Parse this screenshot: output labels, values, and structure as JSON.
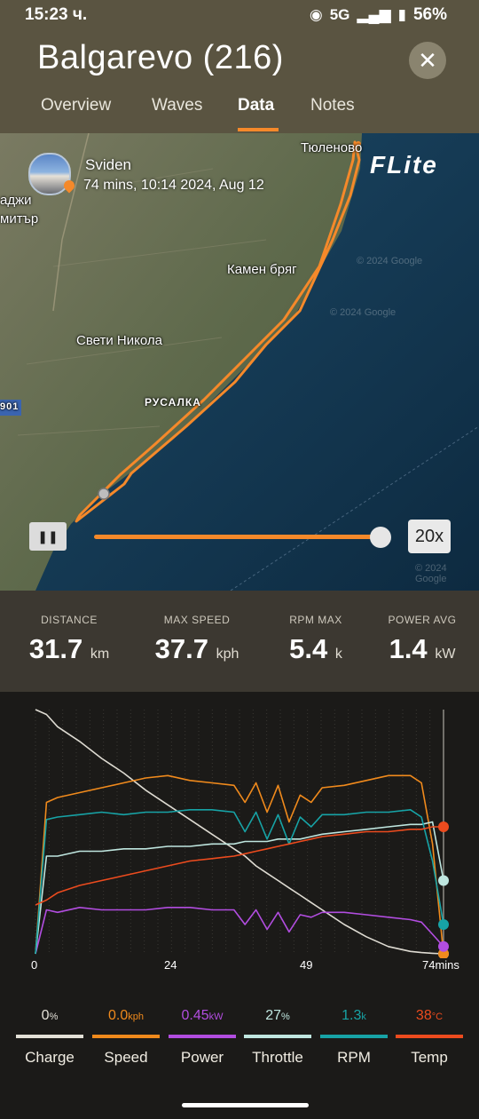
{
  "status_bar": {
    "time": "15:23 ч.",
    "network": "5G",
    "battery": "56%"
  },
  "header": {
    "title": "Balgarevo (216)",
    "close_icon": "close-icon"
  },
  "tabs": [
    {
      "label": "Overview",
      "active": false
    },
    {
      "label": "Waves",
      "active": false
    },
    {
      "label": "Data",
      "active": true
    },
    {
      "label": "Notes",
      "active": false
    }
  ],
  "map": {
    "brand": "FLite",
    "session": {
      "name": "Sviden",
      "meta": "74 mins, 10:14 2024, Aug 12"
    },
    "labels": {
      "tyulenovo": "Тюленово",
      "kamen_bryag": "Камен бряг",
      "sveti_nikola": "Свети Никола",
      "rusalka": "РУСАЛКА",
      "hadzhi": "аджи",
      "dimitar": "митър",
      "road": "901"
    },
    "watermark": "© 2024 Google",
    "playback": {
      "speed_label": "20x",
      "progress": 1.0,
      "pause_icon": "pause-icon"
    }
  },
  "stats": [
    {
      "label": "DISTANCE",
      "value": "31.7",
      "unit": "km"
    },
    {
      "label": "MAX SPEED",
      "value": "37.7",
      "unit": "kph"
    },
    {
      "label": "RPM MAX",
      "value": "5.4",
      "unit": "k"
    },
    {
      "label": "POWER AVG",
      "value": "1.4",
      "unit": "kW"
    }
  ],
  "chart_data": {
    "type": "line",
    "x": [
      0,
      2,
      4,
      8,
      12,
      16,
      20,
      24,
      28,
      32,
      36,
      38,
      40,
      42,
      44,
      46,
      48,
      50,
      52,
      56,
      60,
      64,
      68,
      70,
      72,
      74
    ],
    "xticks": [
      "0",
      "24",
      "49",
      "74mins"
    ],
    "series": [
      {
        "name": "Charge",
        "color": "#dedbd2",
        "values": [
          100,
          98,
          93,
          87,
          80,
          74,
          67,
          61,
          55,
          49,
          43,
          40,
          36,
          33,
          30,
          27,
          24,
          21,
          18,
          12,
          7,
          3,
          1,
          0.5,
          0.2,
          0
        ]
      },
      {
        "name": "Speed",
        "color": "#f08a1c",
        "values": [
          0,
          62,
          64,
          66,
          68,
          70,
          72,
          73,
          71,
          70,
          69,
          62,
          70,
          58,
          69,
          54,
          65,
          62,
          68,
          69,
          71,
          73,
          73,
          70,
          45,
          0
        ]
      },
      {
        "name": "Power",
        "color": "#b24de0",
        "values": [
          0,
          18,
          17,
          19,
          18,
          18,
          18,
          19,
          19,
          18,
          18,
          12,
          18,
          10,
          17,
          9,
          16,
          15,
          17,
          17,
          16,
          15,
          14,
          13,
          8,
          3
        ]
      },
      {
        "name": "Throttle",
        "color": "#bfe6df",
        "values": [
          0,
          40,
          40,
          42,
          42,
          43,
          43,
          44,
          44,
          45,
          45,
          46,
          46,
          46,
          47,
          47,
          47,
          48,
          49,
          50,
          51,
          52,
          53,
          53,
          54,
          30
        ]
      },
      {
        "name": "RPM",
        "color": "#17a3a6",
        "values": [
          0,
          55,
          56,
          57,
          58,
          57,
          58,
          58,
          59,
          59,
          58,
          50,
          58,
          47,
          57,
          45,
          56,
          52,
          57,
          57,
          58,
          58,
          59,
          56,
          38,
          12
        ]
      },
      {
        "name": "Temp",
        "color": "#ec4b1e",
        "values": [
          20,
          22,
          25,
          28,
          30,
          32,
          34,
          36,
          38,
          39,
          40,
          41,
          42,
          43,
          44,
          45,
          46,
          47,
          48,
          49,
          50,
          50,
          51,
          51,
          52,
          52
        ]
      }
    ]
  },
  "legend": [
    {
      "name": "Charge",
      "value": "0",
      "unit": "%",
      "color": "#e3e0d7"
    },
    {
      "name": "Speed",
      "value": "0.0",
      "unit": "kph",
      "color": "#f08a1c"
    },
    {
      "name": "Power",
      "value": "0.45",
      "unit": "kW",
      "color": "#b24de0"
    },
    {
      "name": "Throttle",
      "value": "27",
      "unit": "%",
      "color": "#bfe6df"
    },
    {
      "name": "RPM",
      "value": "1.3",
      "unit": "k",
      "color": "#17a3a6"
    },
    {
      "name": "Temp",
      "value": "38",
      "unit": "°C",
      "color": "#ec4b1e"
    }
  ]
}
